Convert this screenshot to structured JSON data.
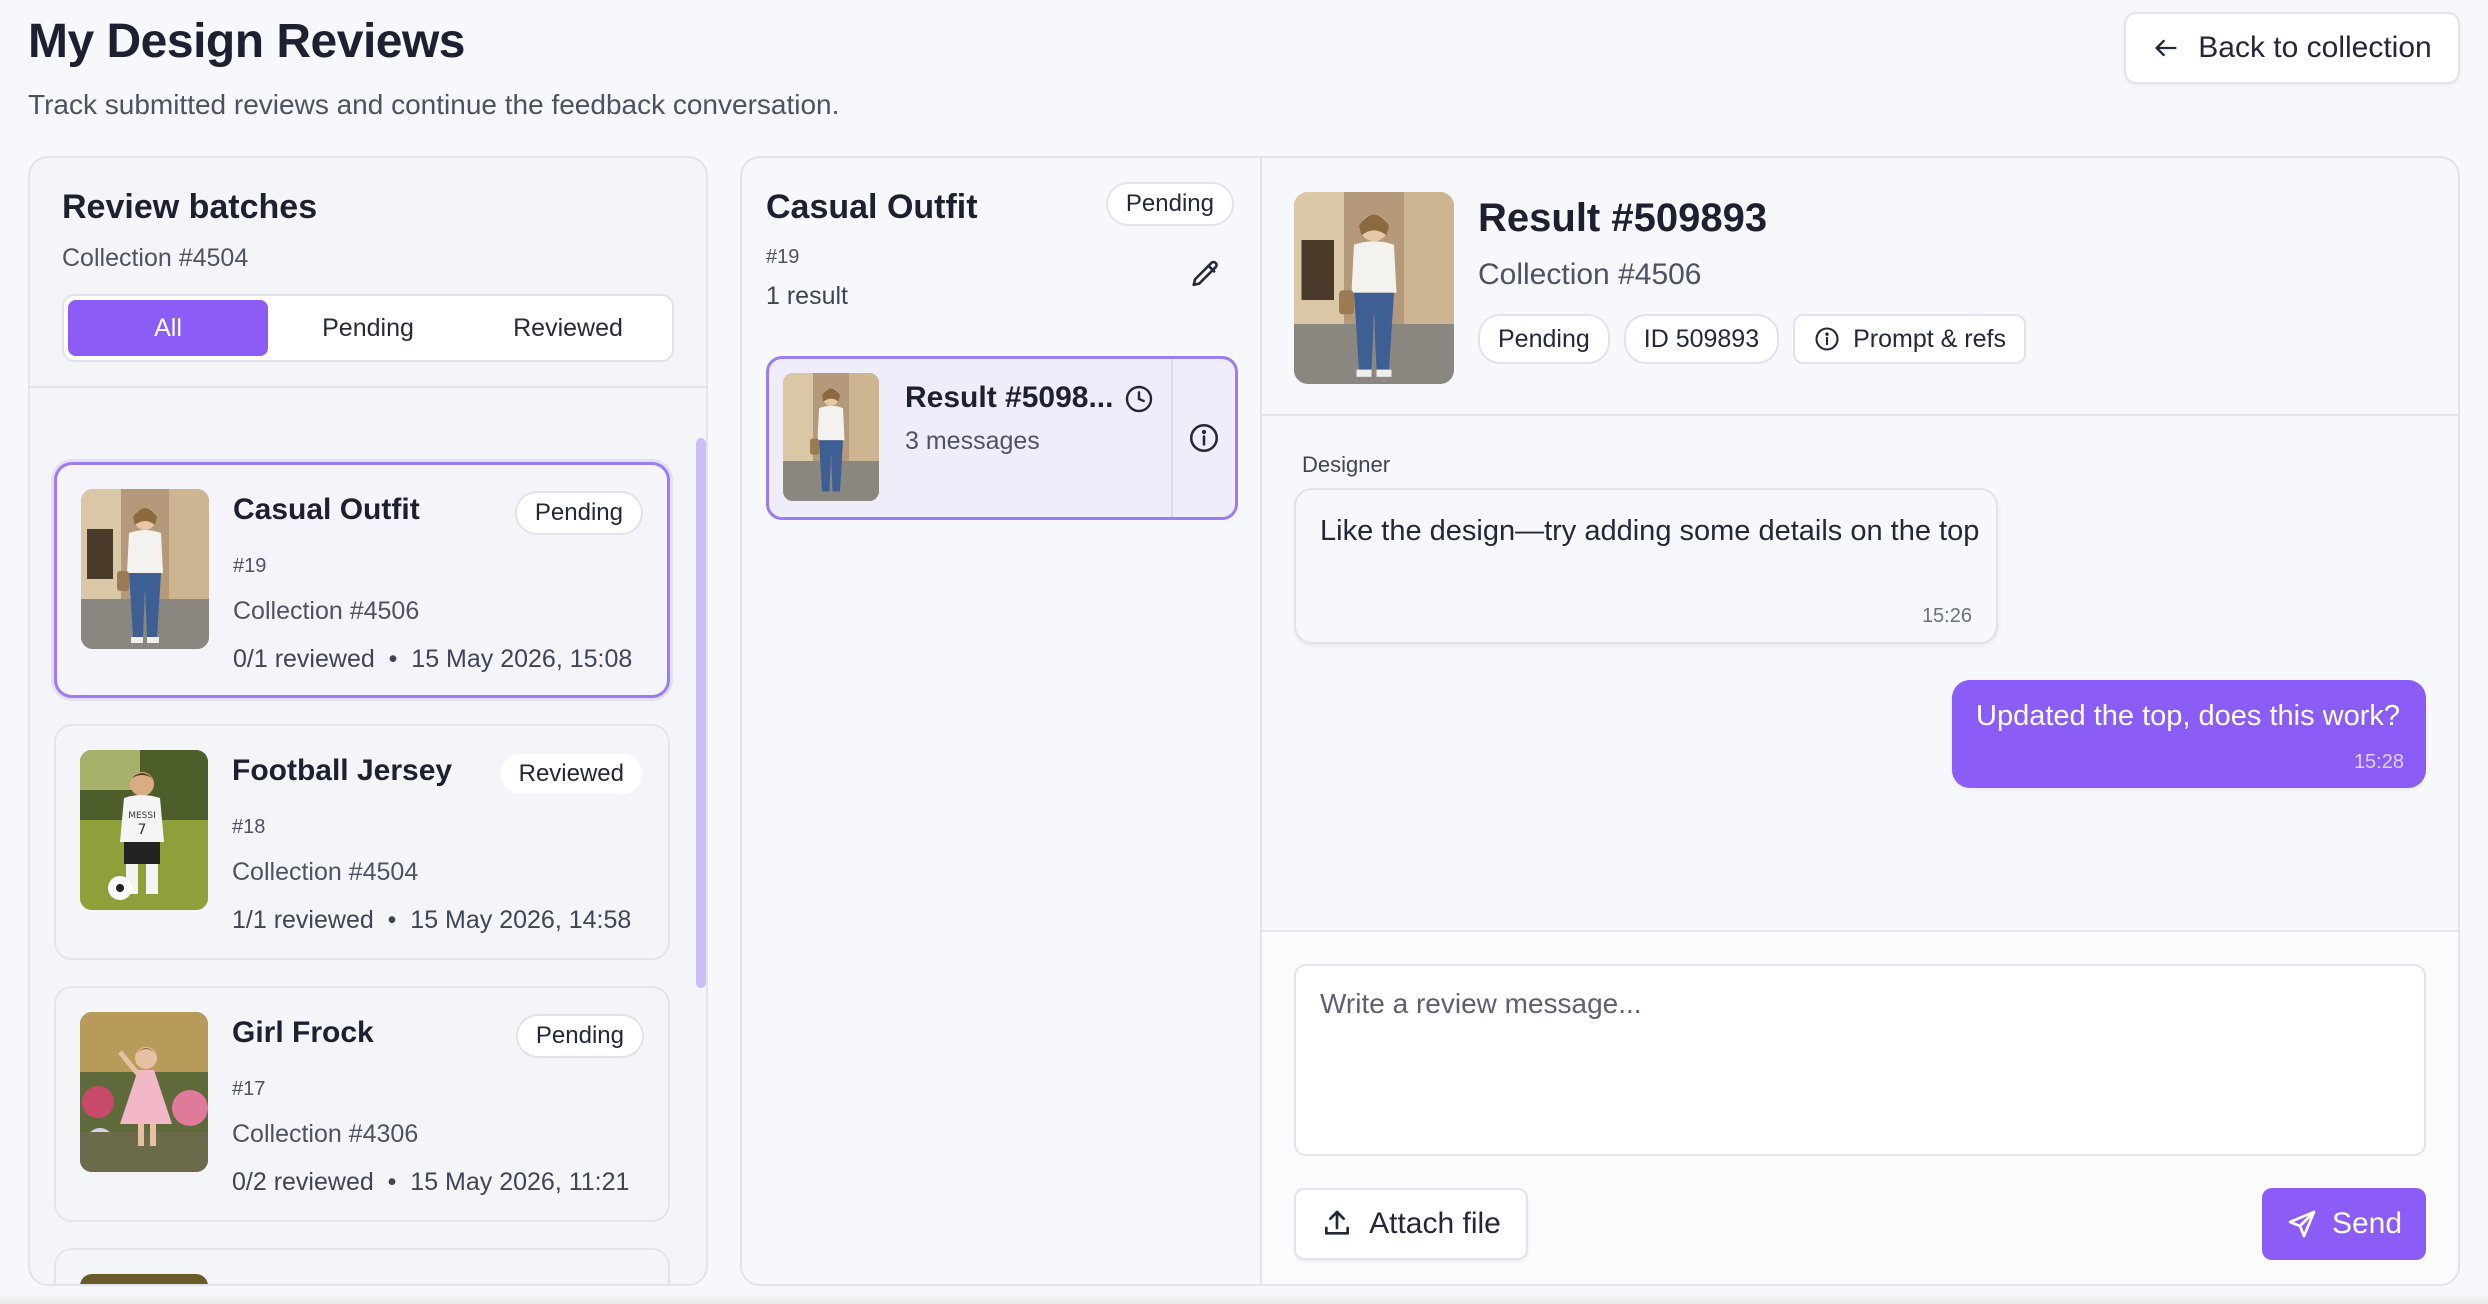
{
  "header": {
    "title": "My Design Reviews",
    "subtitle": "Track submitted reviews and continue the feedback conversation.",
    "back_label": "Back to collection"
  },
  "batches_panel": {
    "title": "Review batches",
    "collection": "Collection #4504",
    "filters": [
      {
        "label": "All",
        "active": true
      },
      {
        "label": "Pending",
        "active": false
      },
      {
        "label": "Reviewed",
        "active": false
      }
    ],
    "items": [
      {
        "name": "Casual Outfit",
        "status": "Pending",
        "number": "#19",
        "collection": "Collection #4506",
        "progress": "0/1 reviewed",
        "date": "15 May 2026, 15:08",
        "selected": true
      },
      {
        "name": "Football Jersey",
        "status": "Reviewed",
        "number": "#18",
        "collection": "Collection #4504",
        "progress": "1/1 reviewed",
        "date": "15 May 2026, 14:58",
        "selected": false
      },
      {
        "name": "Girl Frock",
        "status": "Pending",
        "number": "#17",
        "collection": "Collection #4306",
        "progress": "0/2 reviewed",
        "date": "15 May 2026, 11:21",
        "selected": false
      }
    ]
  },
  "batch_detail": {
    "title": "Casual Outfit",
    "status": "Pending",
    "number": "#19",
    "result_count": "1 result",
    "results": [
      {
        "name": "Result #5098...",
        "messages": "3 messages"
      }
    ]
  },
  "result_view": {
    "title": "Result #509893",
    "collection": "Collection #4506",
    "status": "Pending",
    "id_label": "ID 509893",
    "prompt_label": "Prompt & refs",
    "messages": [
      {
        "sender": "Designer",
        "text": "Like the design—try adding some details on the top",
        "time": "15:26",
        "direction": "incoming"
      },
      {
        "text": "Updated the top, does this work?",
        "time": "15:28",
        "direction": "outgoing"
      }
    ],
    "composer": {
      "placeholder": "Write a review message...",
      "attach_label": "Attach file",
      "send_label": "Send"
    }
  },
  "colors": {
    "accent": "#8b5cf6",
    "accent_border": "#9b7cf2",
    "background": "#f7f8fb"
  }
}
